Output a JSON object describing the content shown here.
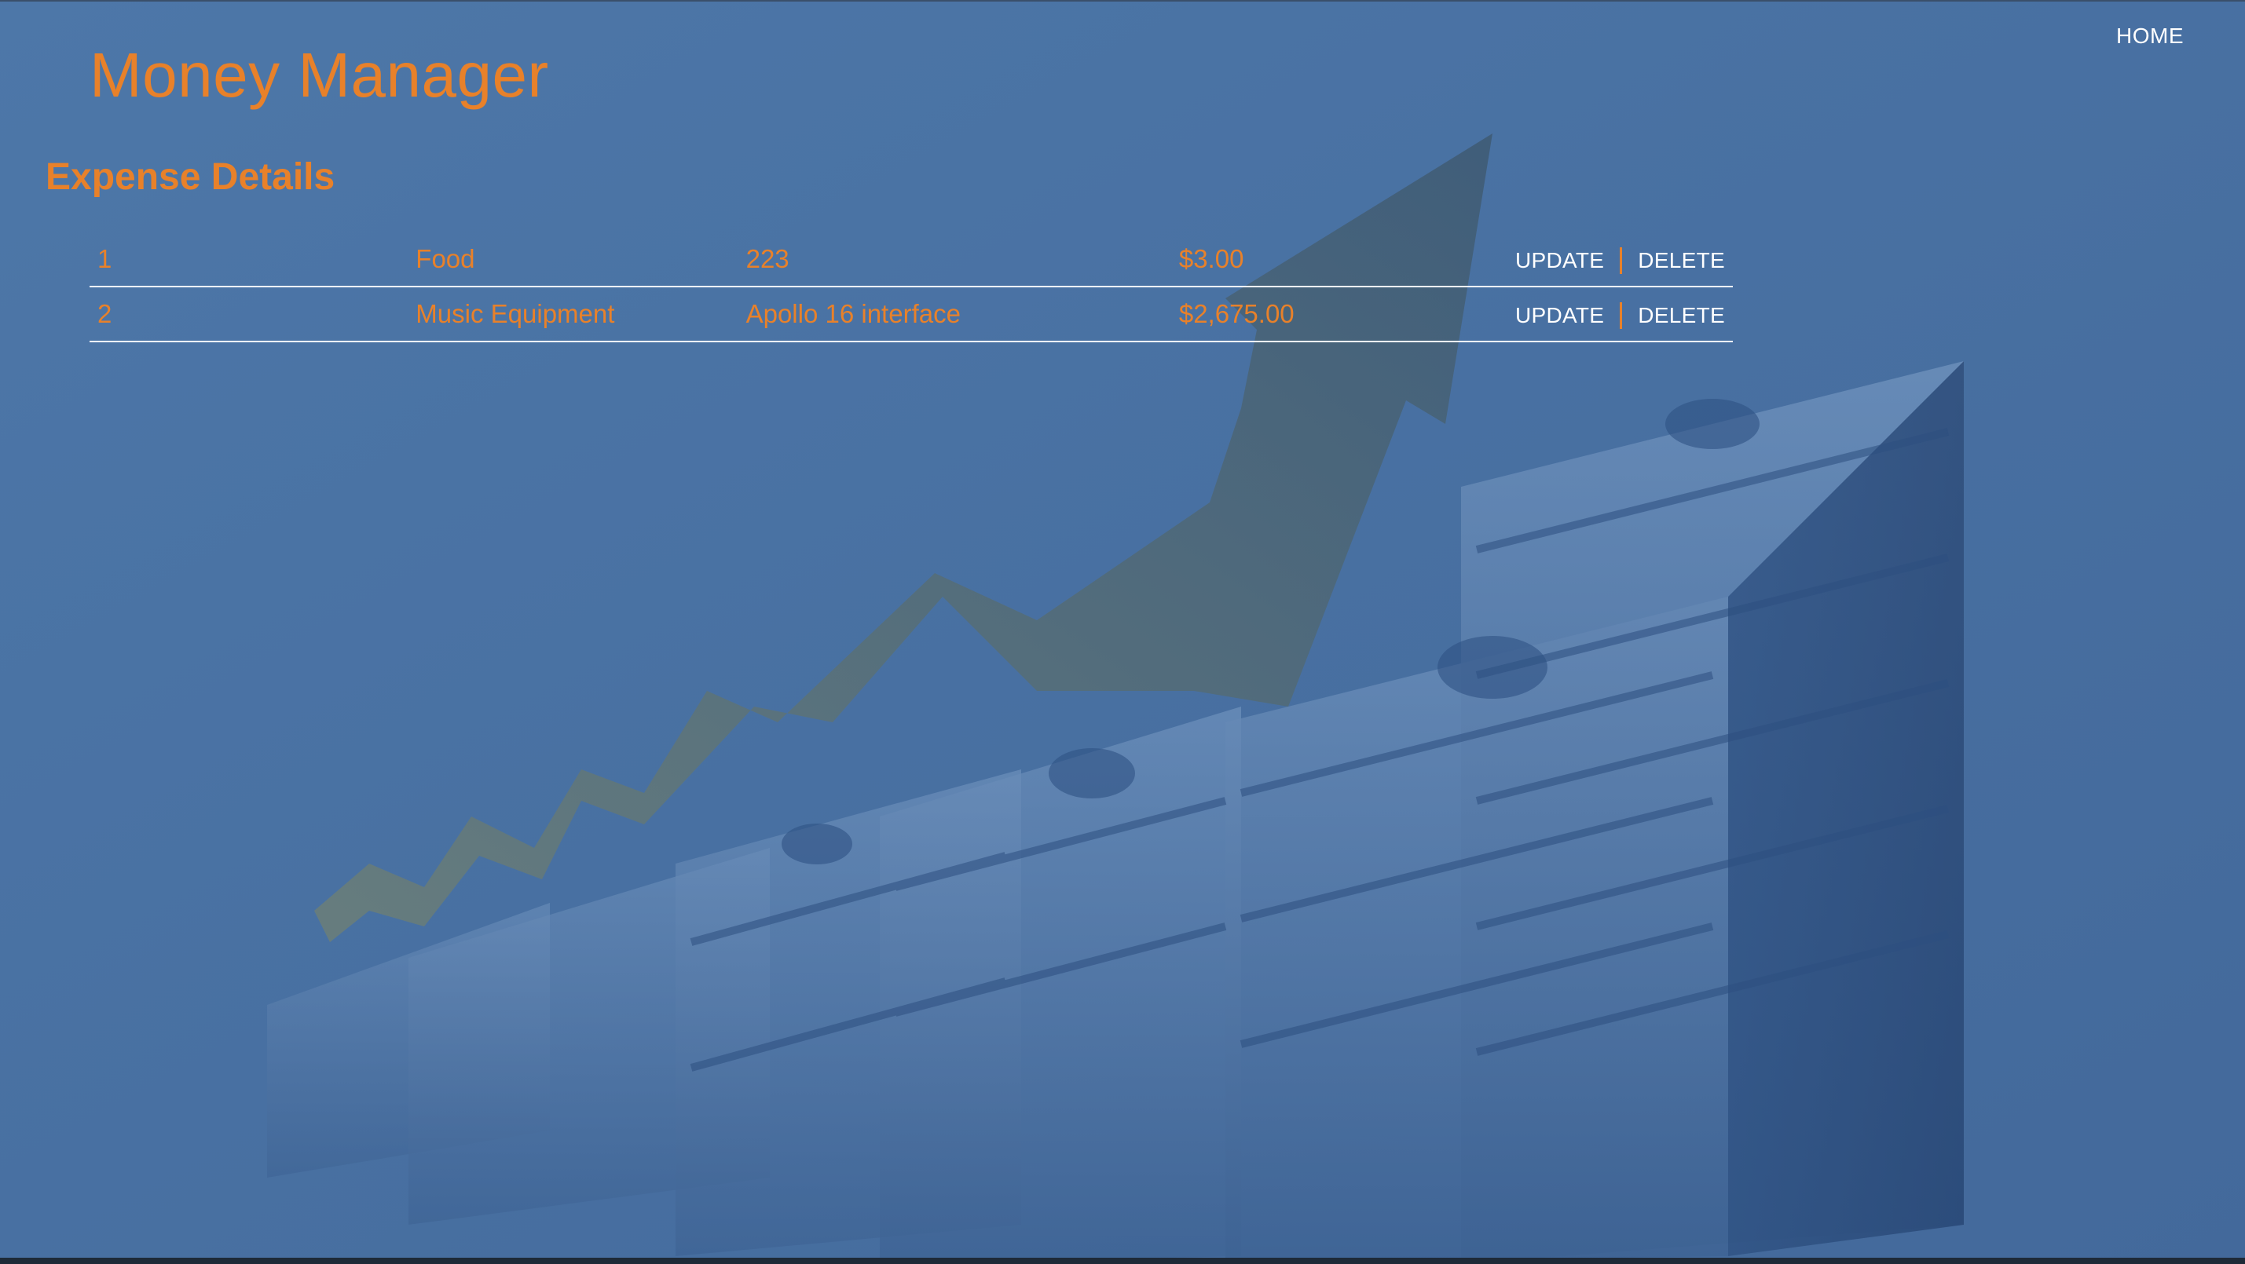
{
  "nav": {
    "home_label": "HOME"
  },
  "header": {
    "app_title": "Money Manager"
  },
  "main": {
    "section_title": "Expense Details",
    "rows": [
      {
        "id": "1",
        "category": "Food",
        "description": "223",
        "amount": "$3.00",
        "update_label": "UPDATE",
        "delete_label": "DELETE"
      },
      {
        "id": "2",
        "category": "Music Equipment",
        "description": "Apollo 16 interface",
        "amount": "$2,675.00",
        "update_label": "UPDATE",
        "delete_label": "DELETE"
      }
    ]
  },
  "colors": {
    "accent": "#e8812a",
    "background_overlay": "#4a73a4",
    "text_light": "#ffffff"
  }
}
